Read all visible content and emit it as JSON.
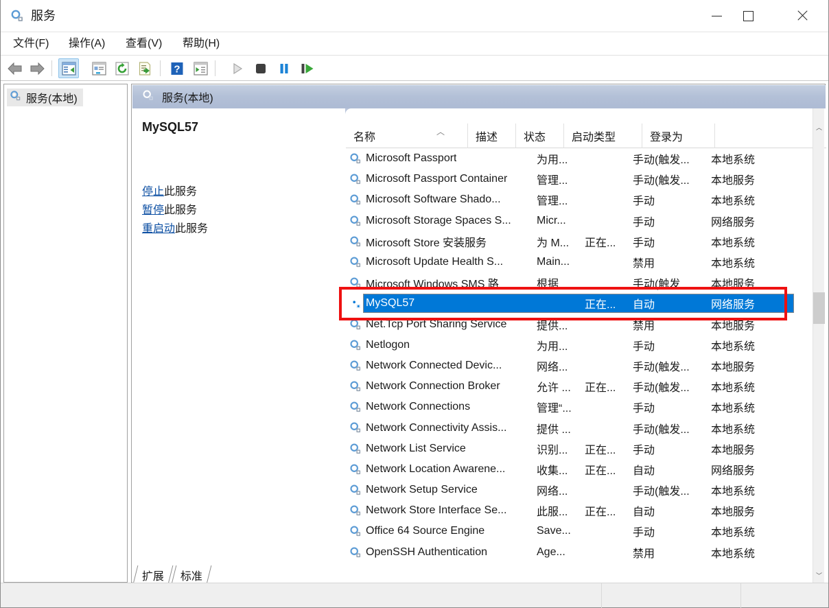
{
  "window": {
    "title": "服务",
    "icon": "services-gear-icon",
    "minimize_label": "最小化",
    "maximize_label": "最大化",
    "close_label": "关闭"
  },
  "menubar": {
    "items": [
      {
        "label": "文件(F)",
        "name": "menu-file"
      },
      {
        "label": "操作(A)",
        "name": "menu-action"
      },
      {
        "label": "查看(V)",
        "name": "menu-view"
      },
      {
        "label": "帮助(H)",
        "name": "menu-help"
      }
    ]
  },
  "toolbar": {
    "items": [
      {
        "name": "back-icon",
        "glyph": "◀"
      },
      {
        "name": "forward-icon",
        "glyph": "▶"
      },
      {
        "name": "show-hide-tree-icon",
        "glyph": "▤"
      },
      {
        "name": "properties-icon",
        "glyph": "▤"
      },
      {
        "name": "refresh-icon",
        "glyph": "⟳"
      },
      {
        "name": "export-list-icon",
        "glyph": "⇥"
      },
      {
        "name": "help-icon",
        "glyph": "?"
      },
      {
        "name": "show-action-pane-icon",
        "glyph": "▤"
      },
      {
        "name": "start-service-icon",
        "glyph": "▶"
      },
      {
        "name": "stop-service-icon",
        "glyph": "■"
      },
      {
        "name": "pause-service-icon",
        "glyph": "❚❚"
      },
      {
        "name": "restart-service-icon",
        "glyph": "❚▶"
      }
    ]
  },
  "tree": {
    "root_label": "服务(本地)",
    "icon": "services-gear-icon"
  },
  "pane": {
    "header_title": "服务(本地)",
    "header_icon": "services-gear-icon"
  },
  "detail": {
    "service_name": "MySQL57",
    "links": [
      {
        "link_text": "停止",
        "rest_text": "此服务",
        "name": "stop-service-link"
      },
      {
        "link_text": "暂停",
        "rest_text": "此服务",
        "name": "pause-service-link"
      },
      {
        "link_text": "重启动",
        "rest_text": "此服务",
        "name": "restart-service-link"
      }
    ]
  },
  "list": {
    "columns": [
      {
        "label": "名称",
        "name": "column-name",
        "sorted": "asc"
      },
      {
        "label": "描述",
        "name": "column-description"
      },
      {
        "label": "状态",
        "name": "column-status"
      },
      {
        "label": "启动类型",
        "name": "column-startup-type"
      },
      {
        "label": "登录为",
        "name": "column-log-on-as"
      }
    ],
    "sort_caret": "︿",
    "rows": [
      {
        "name": "Microsoft Passport",
        "desc": "为用...",
        "status": "",
        "startup": "手动(触发...",
        "logon": "本地系统",
        "selected": false
      },
      {
        "name": "Microsoft Passport Container",
        "desc": "管理...",
        "status": "",
        "startup": "手动(触发...",
        "logon": "本地服务",
        "selected": false
      },
      {
        "name": "Microsoft Software Shado...",
        "desc": "管理...",
        "status": "",
        "startup": "手动",
        "logon": "本地系统",
        "selected": false
      },
      {
        "name": "Microsoft Storage Spaces S...",
        "desc": "Micr...",
        "status": "",
        "startup": "手动",
        "logon": "网络服务",
        "selected": false
      },
      {
        "name": "Microsoft Store 安装服务",
        "desc": "为 M...",
        "status": "正在...",
        "startup": "手动",
        "logon": "本地系统",
        "selected": false
      },
      {
        "name": "Microsoft Update Health S...",
        "desc": "Main...",
        "status": "",
        "startup": "禁用",
        "logon": "本地系统",
        "selected": false
      },
      {
        "name": "Microsoft Windows SMS 路",
        "desc": "根据",
        "status": "",
        "startup": "手动(触发",
        "logon": "本地服务",
        "selected": false
      },
      {
        "name": "MySQL57",
        "desc": "",
        "status": "正在...",
        "startup": "自动",
        "logon": "网络服务",
        "selected": true
      },
      {
        "name": "Net.Tcp Port Sharing Service",
        "desc": "提供...",
        "status": "",
        "startup": "禁用",
        "logon": "本地服务",
        "selected": false
      },
      {
        "name": "Netlogon",
        "desc": "为用...",
        "status": "",
        "startup": "手动",
        "logon": "本地系统",
        "selected": false
      },
      {
        "name": "Network Connected Devic...",
        "desc": "网络...",
        "status": "",
        "startup": "手动(触发...",
        "logon": "本地服务",
        "selected": false
      },
      {
        "name": "Network Connection Broker",
        "desc": "允许 ...",
        "status": "正在...",
        "startup": "手动(触发...",
        "logon": "本地系统",
        "selected": false
      },
      {
        "name": "Network Connections",
        "desc": "管理“...",
        "status": "",
        "startup": "手动",
        "logon": "本地系统",
        "selected": false
      },
      {
        "name": "Network Connectivity Assis...",
        "desc": "提供 ...",
        "status": "",
        "startup": "手动(触发...",
        "logon": "本地系统",
        "selected": false
      },
      {
        "name": "Network List Service",
        "desc": "识别...",
        "status": "正在...",
        "startup": "手动",
        "logon": "本地服务",
        "selected": false
      },
      {
        "name": "Network Location Awarene...",
        "desc": "收集...",
        "status": "正在...",
        "startup": "自动",
        "logon": "网络服务",
        "selected": false
      },
      {
        "name": "Network Setup Service",
        "desc": "网络...",
        "status": "",
        "startup": "手动(触发...",
        "logon": "本地系统",
        "selected": false
      },
      {
        "name": "Network Store Interface Se...",
        "desc": "此服...",
        "status": "正在...",
        "startup": "自动",
        "logon": "本地服务",
        "selected": false
      },
      {
        "name": "Office 64 Source Engine",
        "desc": "Save...",
        "status": "",
        "startup": "手动",
        "logon": "本地系统",
        "selected": false
      },
      {
        "name": "OpenSSH Authentication",
        "desc": "Age...",
        "status": "",
        "startup": "禁用",
        "logon": "本地系统",
        "selected": false
      }
    ],
    "scroll_up_glyph": "︿",
    "scroll_down_glyph": "﹀"
  },
  "tabs": [
    {
      "label": "扩展",
      "name": "tab-extended",
      "active": false
    },
    {
      "label": "标准",
      "name": "tab-standard",
      "active": true
    }
  ],
  "annotation": {
    "color": "#ee1111",
    "target": "MySQL57"
  },
  "colors": {
    "selection_blue": "#0078d7",
    "header_band": "#b3c0d7",
    "link_blue": "#0b4ea2",
    "annotation_red": "#ee1111"
  }
}
